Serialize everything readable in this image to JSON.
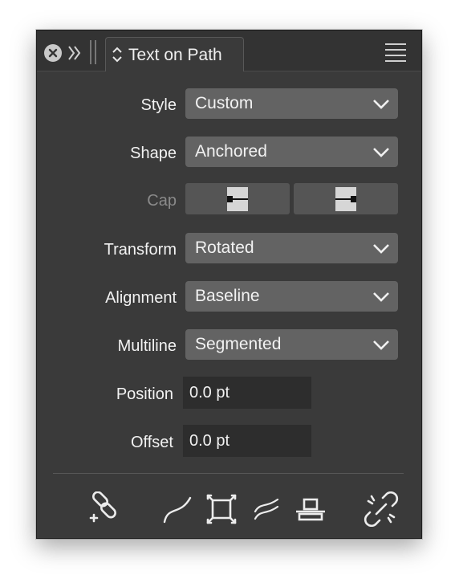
{
  "panel": {
    "tab_title": "Text on Path"
  },
  "icons": {
    "close": "close-icon",
    "collapse": "double-chevron-right-icon",
    "grip": "grip-handle-icon",
    "tab_chevrons": "updown-chevron-icon",
    "menu": "hamburger-menu-icon"
  },
  "fields": {
    "style": {
      "label": "Style",
      "value": "Custom"
    },
    "shape": {
      "label": "Shape",
      "value": "Anchored"
    },
    "cap": {
      "label": "Cap"
    },
    "transform": {
      "label": "Transform",
      "value": "Rotated"
    },
    "alignment": {
      "label": "Alignment",
      "value": "Baseline"
    },
    "multiline": {
      "label": "Multiline",
      "value": "Segmented"
    },
    "position": {
      "label": "Position",
      "value": "0.0 pt"
    },
    "offset": {
      "label": "Offset",
      "value": "0.0 pt"
    }
  },
  "toolbar": [
    "link-path-icon",
    "curve-path-icon",
    "transform-box-icon",
    "double-curve-icon",
    "baseline-align-icon",
    "unlink-path-icon"
  ],
  "colors": {
    "panel_bg": "#3a3a3a",
    "dropdown_bg": "#636363",
    "field_bg": "#2d2d2d",
    "text": "#f2f2f2",
    "disabled_text": "#8a8a8a"
  }
}
